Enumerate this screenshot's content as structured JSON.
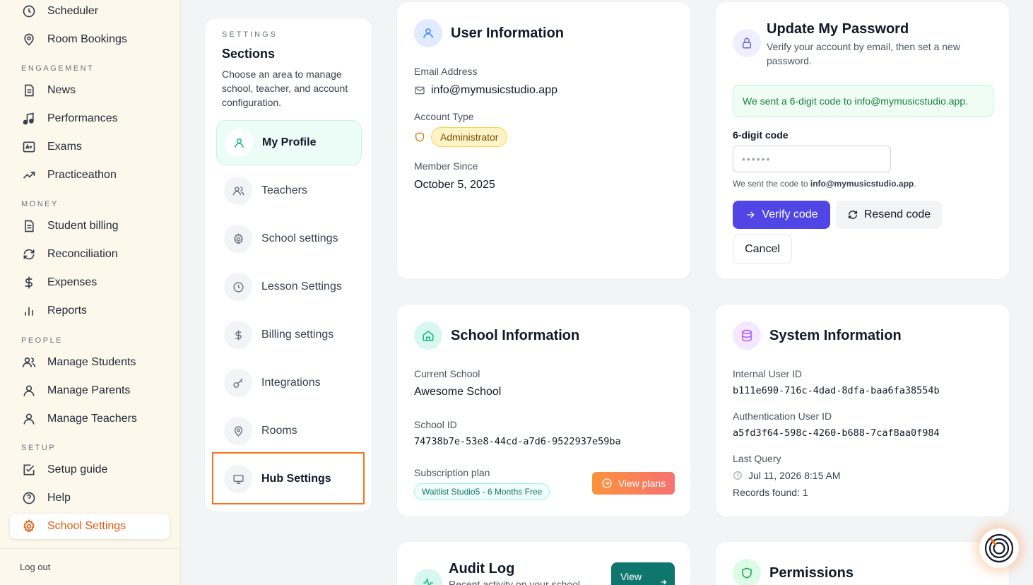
{
  "sidebar": {
    "items": [
      {
        "label": "Scheduler",
        "icon": "clock-icon"
      },
      {
        "label": "Room Bookings",
        "icon": "map-pin-icon"
      },
      {
        "label": "News",
        "icon": "document-icon"
      },
      {
        "label": "Performances",
        "icon": "music-note-icon"
      },
      {
        "label": "Exams",
        "icon": "grade-icon"
      },
      {
        "label": "Practiceathon",
        "icon": "trending-up-icon"
      },
      {
        "label": "Student billing",
        "icon": "document-icon"
      },
      {
        "label": "Reconciliation",
        "icon": "refresh-icon"
      },
      {
        "label": "Expenses",
        "icon": "dollar-icon"
      },
      {
        "label": "Reports",
        "icon": "bar-chart-icon"
      },
      {
        "label": "Manage Students",
        "icon": "users-icon"
      },
      {
        "label": "Manage Parents",
        "icon": "user-icon"
      },
      {
        "label": "Manage Teachers",
        "icon": "user-icon"
      },
      {
        "label": "Setup guide",
        "icon": "checkbox-icon"
      },
      {
        "label": "Help",
        "icon": "help-circle-icon"
      },
      {
        "label": "School Settings",
        "icon": "gear-icon",
        "active": true
      }
    ],
    "headings": {
      "engagement": "ENGAGEMENT",
      "money": "MONEY",
      "people": "PEOPLE",
      "setup": "SETUP"
    },
    "logout": "Log out"
  },
  "sections": {
    "eyebrow": "SETTINGS",
    "title": "Sections",
    "description": "Choose an area to manage school, teacher, and account configuration.",
    "items": [
      {
        "label": "My Profile",
        "icon": "user-icon",
        "active": true
      },
      {
        "label": "Teachers",
        "icon": "users-icon"
      },
      {
        "label": "School settings",
        "icon": "gear-icon"
      },
      {
        "label": "Lesson Settings",
        "icon": "clock-icon"
      },
      {
        "label": "Billing settings",
        "icon": "dollar-icon"
      },
      {
        "label": "Integrations",
        "icon": "key-icon"
      },
      {
        "label": "Rooms",
        "icon": "map-pin-icon"
      },
      {
        "label": "Hub Settings",
        "icon": "monitor-icon"
      }
    ]
  },
  "user_info": {
    "title": "User Information",
    "email_label": "Email Address",
    "email": "info@mymusicstudio.app",
    "account_type_label": "Account Type",
    "account_type": "Administrator",
    "member_since_label": "Member Since",
    "member_since": "October 5, 2025"
  },
  "password": {
    "title": "Update My Password",
    "subtitle": "Verify your account by email, then set a new password.",
    "alert": "We sent a 6-digit code to info@mymusicstudio.app.",
    "code_label": "6-digit code",
    "code_placeholder": "••••••",
    "hint_prefix": "We sent the code to ",
    "hint_email": "info@mymusicstudio.app",
    "hint_suffix": ".",
    "verify": "Verify code",
    "resend": "Resend code",
    "cancel": "Cancel"
  },
  "school_info": {
    "title": "School Information",
    "current_label": "Current School",
    "current": "Awesome School",
    "id_label": "School ID",
    "id": "74738b7e-53e8-44cd-a7d6-9522937e59ba",
    "plan_label": "Subscription plan",
    "plan": "Waitlist Studio5 - 6 Months Free",
    "view_plans": "View plans"
  },
  "system_info": {
    "title": "System Information",
    "internal_label": "Internal User ID",
    "internal": "b111e690-716c-4dad-8dfa-baa6fa38554b",
    "auth_label": "Authentication User ID",
    "auth": "a5fd3f64-598c-4260-b688-7caf8aa0f984",
    "last_query_label": "Last Query",
    "last_query": "Jul 11, 2026 8:15 AM",
    "records": "Records found: 1"
  },
  "audit_log": {
    "title": "Audit Log",
    "subtitle": "Recent activity on your school",
    "view": "View"
  },
  "permissions": {
    "title": "Permissions"
  },
  "colors": {
    "accent": "#ea580c",
    "primary": "#4f46e5",
    "teal": "#0f766e",
    "highlight": "#f97316"
  }
}
